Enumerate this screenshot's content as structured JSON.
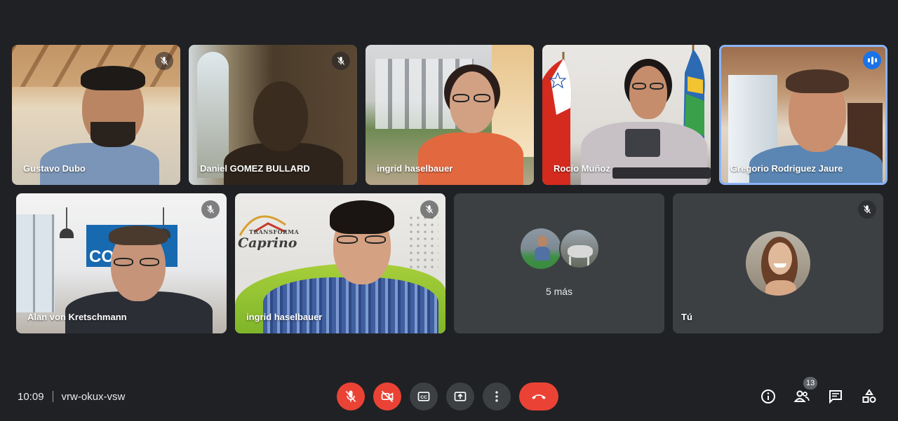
{
  "participants": [
    {
      "name": "Gustavo Dubo",
      "muted": true
    },
    {
      "name": "Daniel GOMEZ BULLARD",
      "muted": true
    },
    {
      "name": "ingrid haselbauer",
      "muted": false
    },
    {
      "name": "Rocío Muñoz",
      "muted": false
    },
    {
      "name": "Gregorio Rodriguez Jaure",
      "muted": false,
      "speaking": true
    },
    {
      "name": "Alan von Kretschmann",
      "muted": true
    },
    {
      "name": "ingrid haselbauer",
      "muted": true
    },
    {
      "name": "Tú",
      "muted": true
    }
  ],
  "more": {
    "label": "5 más"
  },
  "backgrounds": {
    "alan_logo": "CO",
    "caprino_small": "TRANSFORMA",
    "caprino_big": "Caprino"
  },
  "meeting": {
    "time": "10:09",
    "code": "vrw-okux-vsw"
  },
  "participant_count": "13",
  "colors": {
    "bg": "#202124",
    "tile": "#3c4043",
    "red": "#ea4335",
    "active_border": "#8ab4f8",
    "speak": "#1a73e8"
  },
  "icons": [
    "mic-off-icon",
    "camera-off-icon",
    "captions-icon",
    "present-icon",
    "more-vert-icon",
    "hang-up-icon",
    "info-icon",
    "people-icon",
    "chat-icon",
    "activities-icon",
    "speaking-icon"
  ]
}
